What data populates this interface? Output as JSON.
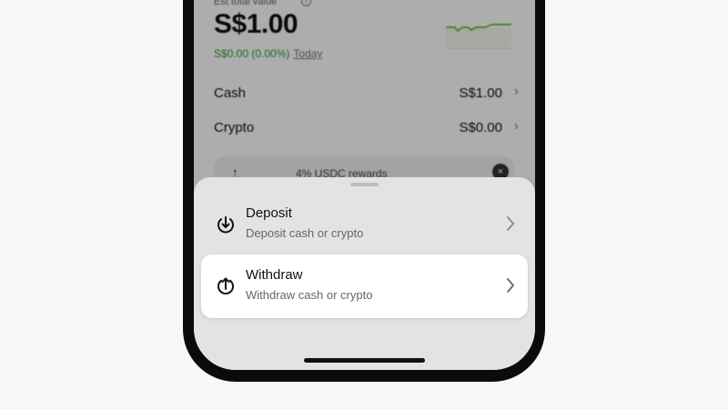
{
  "portfolio": {
    "est_label": "Est total value",
    "total": "S$1.00",
    "change": "S$0.00 (0.00%)",
    "period": "Today"
  },
  "balances": [
    {
      "label": "Cash",
      "value": "S$1.00"
    },
    {
      "label": "Crypto",
      "value": "S$0.00"
    }
  ],
  "promo": {
    "text": "4% USDC rewards"
  },
  "sheet": {
    "items": [
      {
        "title": "Deposit",
        "subtitle": "Deposit cash or crypto",
        "icon": "arrow-down-circle-icon"
      },
      {
        "title": "Withdraw",
        "subtitle": "Withdraw cash or crypto",
        "icon": "arrow-up-circle-icon",
        "selected": true
      }
    ]
  },
  "colors": {
    "positive": "#2e9e2e",
    "sheet_bg": "#e3e3e3",
    "selected_bg": "#ffffff"
  }
}
